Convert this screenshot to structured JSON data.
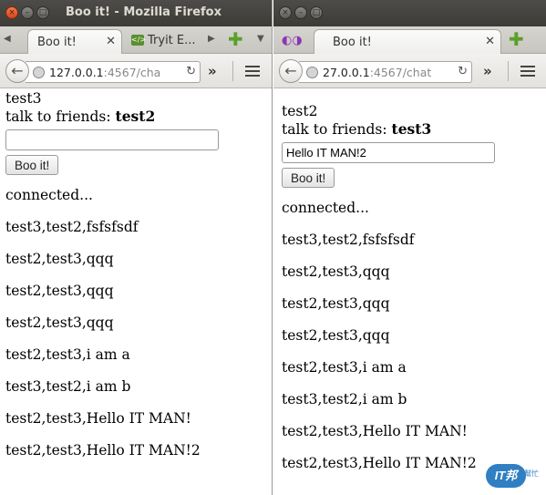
{
  "left_window": {
    "title": "Boo it! - Mozilla Firefox",
    "tabs": [
      "Boo it!",
      "Tryit E..."
    ],
    "url_host": "127.0.0.1",
    "url_rest": ":4567/cha",
    "user": "test3",
    "talk_label": "talk to friends:",
    "friend": "test2",
    "input_value": "",
    "button_label": "Boo it!",
    "messages": [
      "connected...",
      "test3,test2,fsfsfsdf",
      "test2,test3,qqq",
      "test2,test3,qqq",
      "test2,test3,qqq",
      "test2,test3,i am a",
      "test3,test2,i am b",
      "test2,test3,Hello IT MAN!",
      "test2,test3,Hello IT MAN!2"
    ]
  },
  "right_window": {
    "tabs": [
      "Boo it!"
    ],
    "url_host": "27.0.0.1",
    "url_rest": ":4567/chat",
    "user": "test2",
    "talk_label": "talk to friends:",
    "friend": "test3",
    "input_value": "Hello IT MAN!2",
    "button_label": "Boo it!",
    "messages": [
      "connected...",
      "test3,test2,fsfsfsdf",
      "test2,test3,qqq",
      "test2,test3,qqq",
      "test2,test3,qqq",
      "test2,test3,i am a",
      "test3,test2,i am b",
      "test2,test3,Hello IT MAN!",
      "test2,test3,Hello IT MAN!2"
    ]
  },
  "watermark": {
    "badge": "IT邦",
    "sub": "幫忙"
  },
  "colors": {
    "titlebar": "#3c3b37",
    "close_button": "#e05a2b",
    "watermark": "#2f7fc2"
  }
}
